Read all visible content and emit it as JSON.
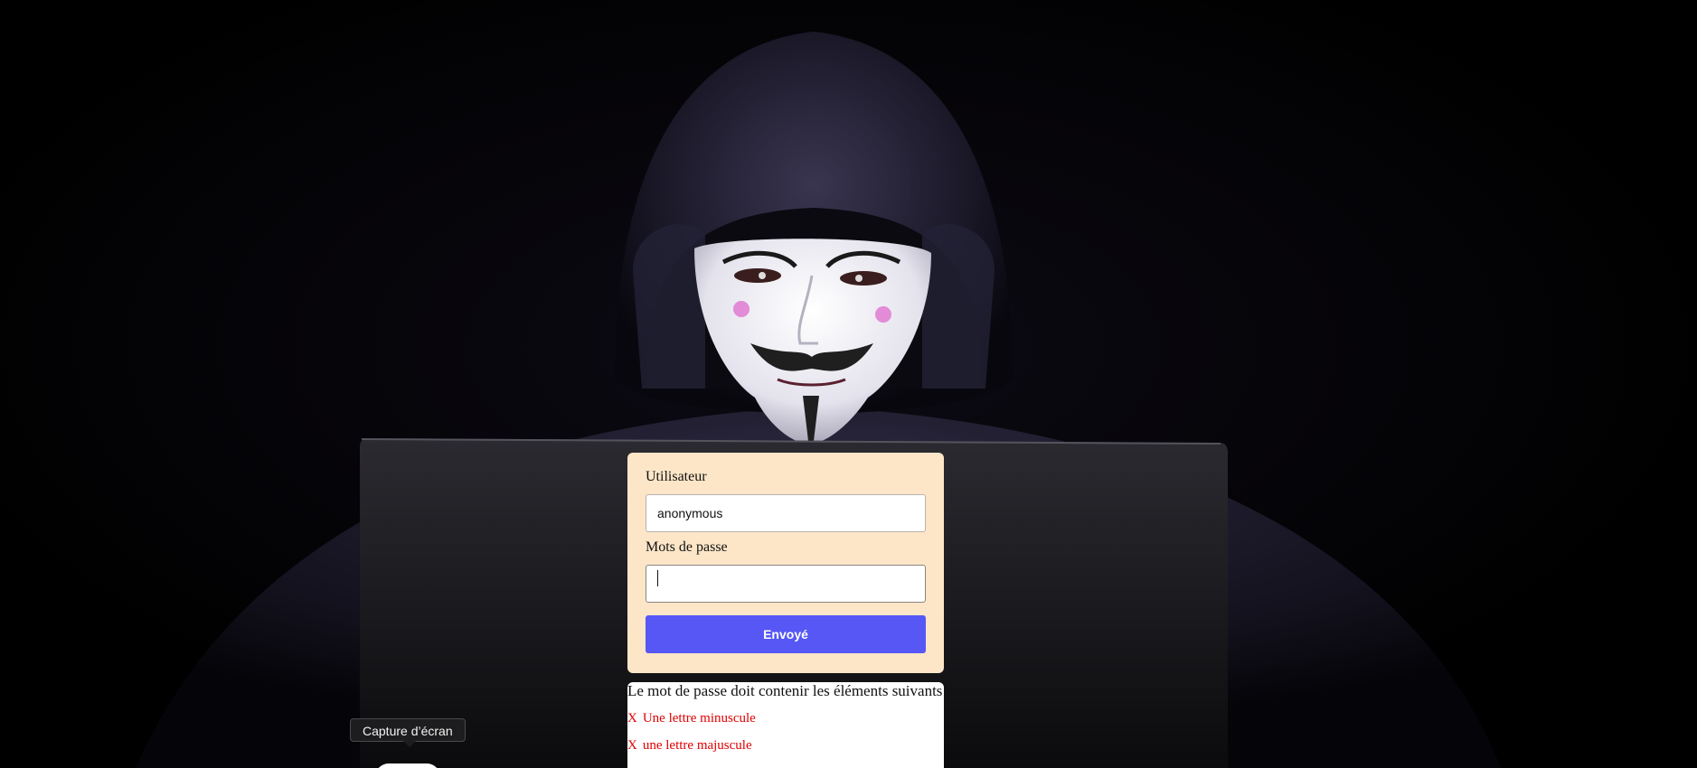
{
  "login": {
    "username_label": "Utilisateur",
    "username_value": "anonymous",
    "password_label": "Mots de passe",
    "password_value": "",
    "submit_label": "Envoyé"
  },
  "password_rules": {
    "title": "Le mot de passe doit contenir les éléments suivants",
    "items": [
      {
        "mark": "X",
        "text": "Une lettre minuscule"
      },
      {
        "mark": "X",
        "text": "une lettre majuscule"
      }
    ]
  },
  "tooltip": {
    "label": "Capture d’écran"
  },
  "colors": {
    "card_background": "#fde6c8",
    "button_background": "#5657f5",
    "rule_invalid": "#e00000"
  },
  "background_image": "hooded figure wearing a white Guy Fawkes mask behind a laptop"
}
